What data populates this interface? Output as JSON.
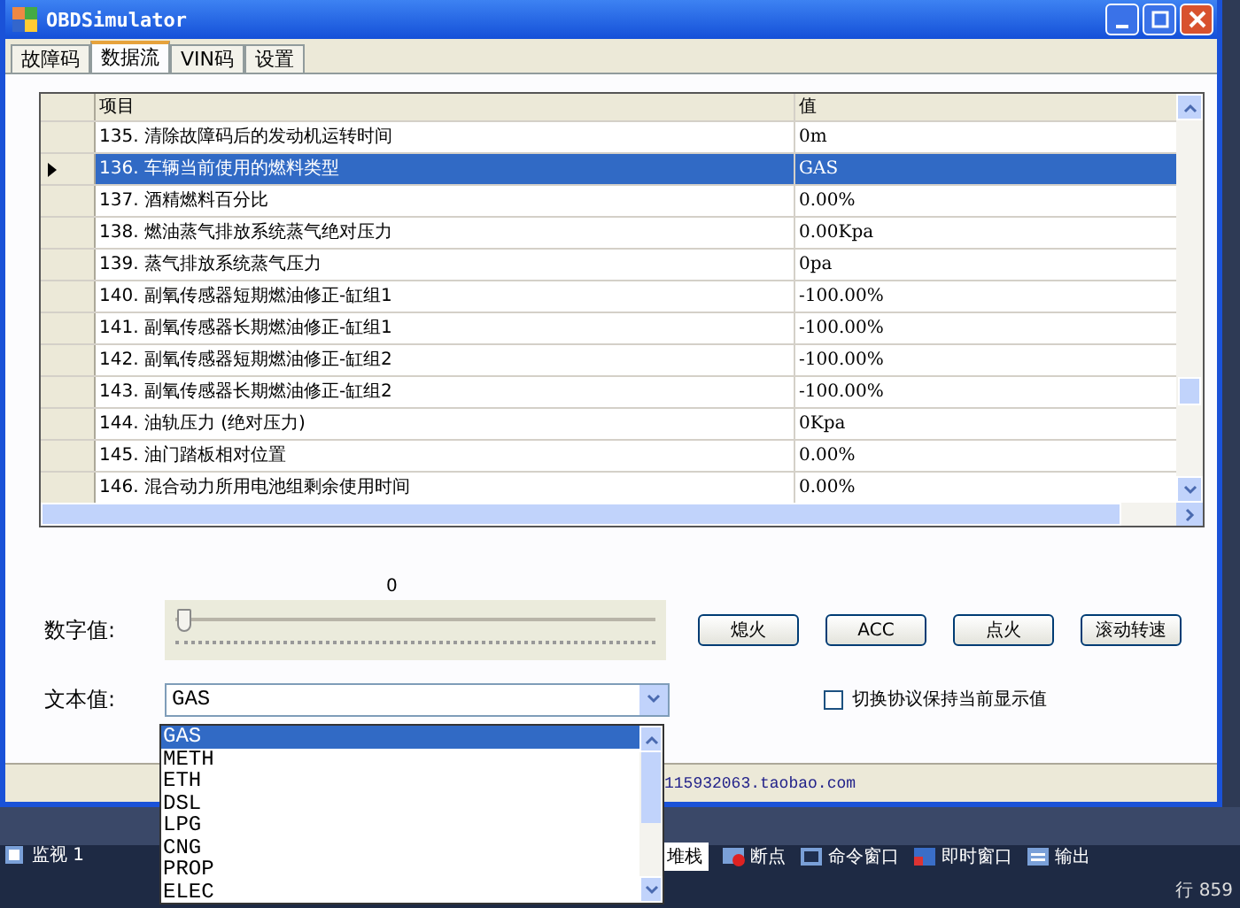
{
  "window": {
    "title": "OBDSimulator"
  },
  "tabs": [
    {
      "label": "故障码",
      "selected": false
    },
    {
      "label": "数据流",
      "selected": true
    },
    {
      "label": "VIN码",
      "selected": false
    },
    {
      "label": "设置",
      "selected": false
    }
  ],
  "grid": {
    "columns": [
      "项目",
      "值"
    ],
    "rows": [
      {
        "item": "135. 清除故障码后的发动机运转时间",
        "value": "0m",
        "selected": false
      },
      {
        "item": "136. 车辆当前使用的燃料类型",
        "value": "GAS",
        "selected": true
      },
      {
        "item": "137. 酒精燃料百分比",
        "value": "0.00%",
        "selected": false
      },
      {
        "item": "138. 燃油蒸气排放系统蒸气绝对压力",
        "value": "0.00Kpa",
        "selected": false
      },
      {
        "item": "139. 蒸气排放系统蒸气压力",
        "value": "0pa",
        "selected": false
      },
      {
        "item": "140. 副氧传感器短期燃油修正-缸组1",
        "value": "-100.00%",
        "selected": false
      },
      {
        "item": "141. 副氧传感器长期燃油修正-缸组1",
        "value": "-100.00%",
        "selected": false
      },
      {
        "item": "142. 副氧传感器短期燃油修正-缸组2",
        "value": "-100.00%",
        "selected": false
      },
      {
        "item": "143. 副氧传感器长期燃油修正-缸组2",
        "value": "-100.00%",
        "selected": false
      },
      {
        "item": "144. 油轨压力 (绝对压力)",
        "value": "0Kpa",
        "selected": false
      },
      {
        "item": "145. 油门踏板相对位置",
        "value": "0.00%",
        "selected": false
      },
      {
        "item": "146. 混合动力所用电池组剩余使用时间",
        "value": "0.00%",
        "selected": false
      }
    ]
  },
  "numeric": {
    "label": "数字值:",
    "reading": "0",
    "level": 0
  },
  "buttons": [
    "熄火",
    "ACC",
    "点火",
    "滚动转速"
  ],
  "text_value": {
    "label": "文本值:",
    "value": "GAS",
    "options": [
      {
        "label": "GAS",
        "selected": true
      },
      {
        "label": "METH",
        "selected": false
      },
      {
        "label": "ETH",
        "selected": false
      },
      {
        "label": "DSL",
        "selected": false
      },
      {
        "label": "LPG",
        "selected": false
      },
      {
        "label": "CNG",
        "selected": false
      },
      {
        "label": "PROP",
        "selected": false
      },
      {
        "label": "ELEC",
        "selected": false
      }
    ]
  },
  "checkbox": {
    "label": "切换协议保持当前显示值",
    "checked": false
  },
  "status_bar": "115932063.taobao.com",
  "ide": {
    "left_tab": "监视 1",
    "tabs": [
      {
        "label": "堆栈",
        "kind": "plain",
        "selected": true
      },
      {
        "label": "断点",
        "kind": "breakpoint",
        "selected": false
      },
      {
        "label": "命令窗口",
        "kind": "command",
        "selected": false
      },
      {
        "label": "即时窗口",
        "kind": "immediate",
        "selected": false
      },
      {
        "label": "输出",
        "kind": "output",
        "selected": false
      }
    ],
    "line": "行 859"
  }
}
